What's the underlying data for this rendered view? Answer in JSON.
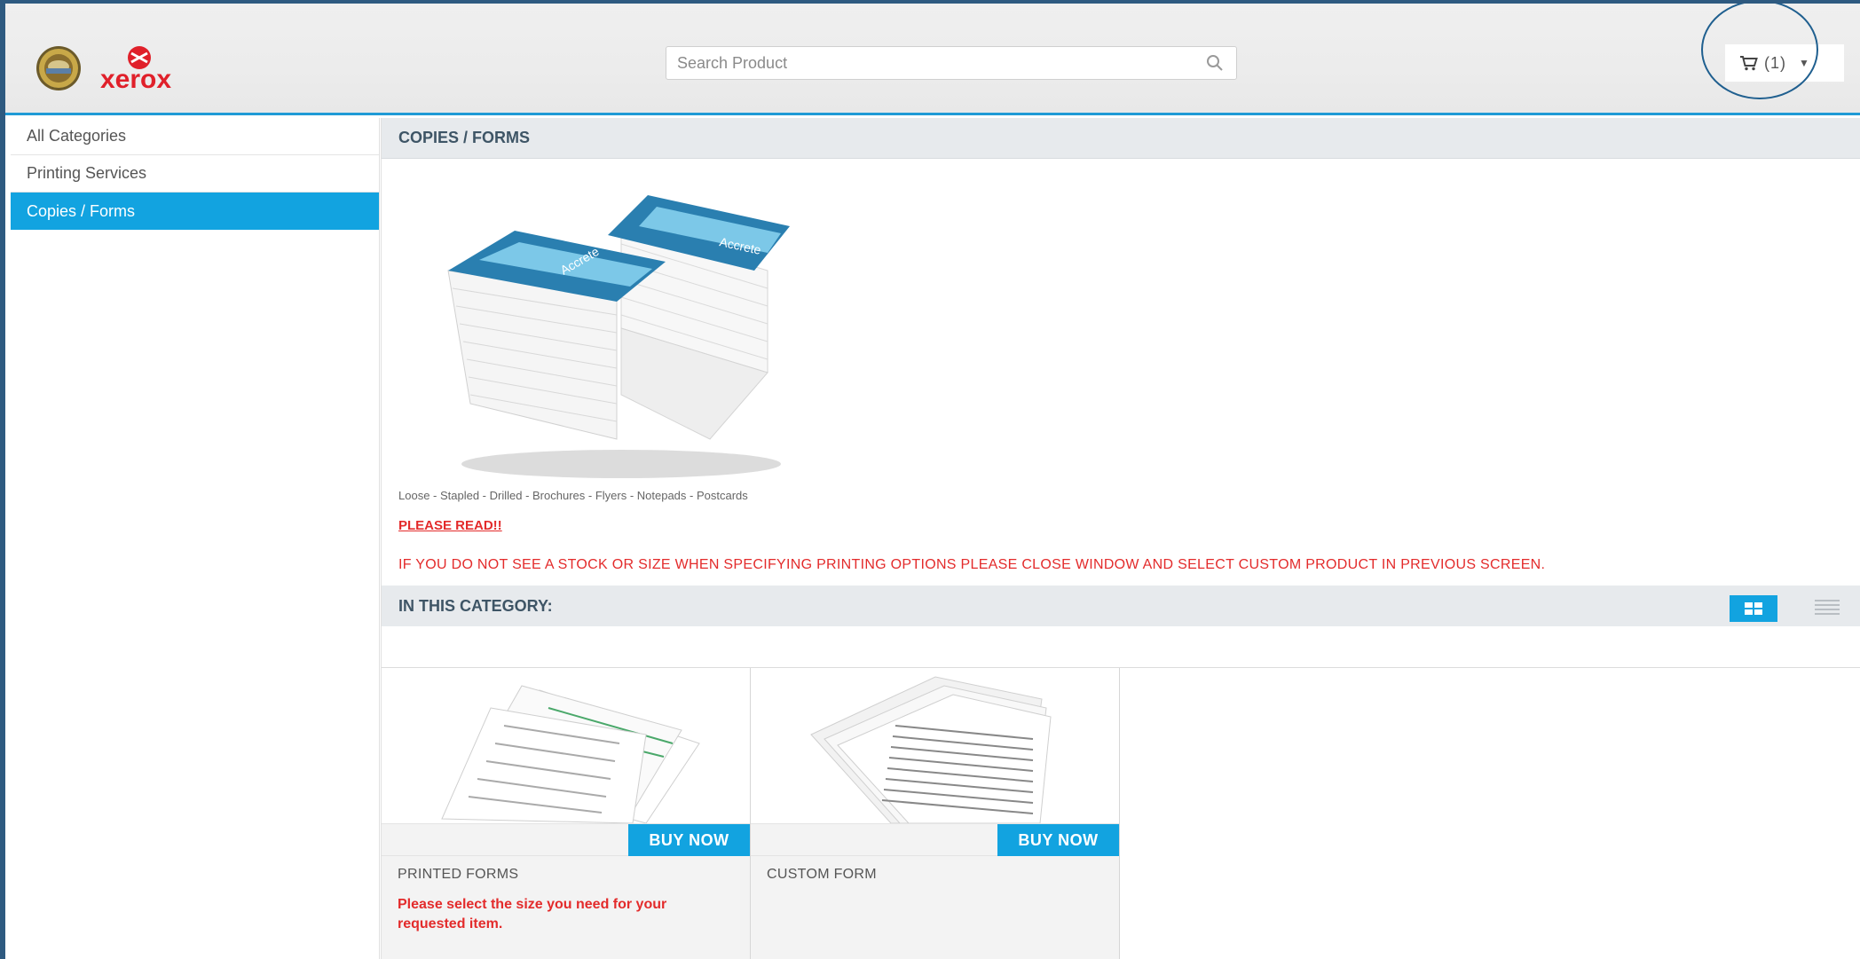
{
  "header": {
    "search_placeholder": "Search Product",
    "cart_label": "(1)",
    "logo_text": "xerox"
  },
  "sidebar": {
    "items": [
      {
        "label": "All Categories"
      },
      {
        "label": "Printing Services"
      },
      {
        "label": "Copies / Forms"
      }
    ]
  },
  "main": {
    "title": "COPIES / FORMS",
    "tagline": "Loose - Stapled - Drilled - Brochures - Flyers - Notepads - Postcards",
    "please_read": "PLEASE READ!!",
    "notice": "IF YOU DO NOT SEE A STOCK OR SIZE WHEN SPECIFYING PRINTING OPTIONS PLEASE CLOSE WINDOW AND SELECT CUSTOM PRODUCT IN PREVIOUS SCREEN.",
    "category_title": "IN THIS CATEGORY:",
    "products": [
      {
        "name": "PRINTED FORMS",
        "buy_label": "BUY NOW",
        "description": "Please select the size you need for your requested item."
      },
      {
        "name": "CUSTOM FORM",
        "buy_label": "BUY NOW",
        "description": ""
      }
    ]
  },
  "colors": {
    "accent": "#12a3e0",
    "alert": "#e32b2b",
    "frame": "#2e5a80"
  },
  "icons": {
    "search": "search-icon",
    "cart": "cart-icon",
    "grid_view": "grid-view-icon",
    "list_view": "list-view-icon"
  }
}
